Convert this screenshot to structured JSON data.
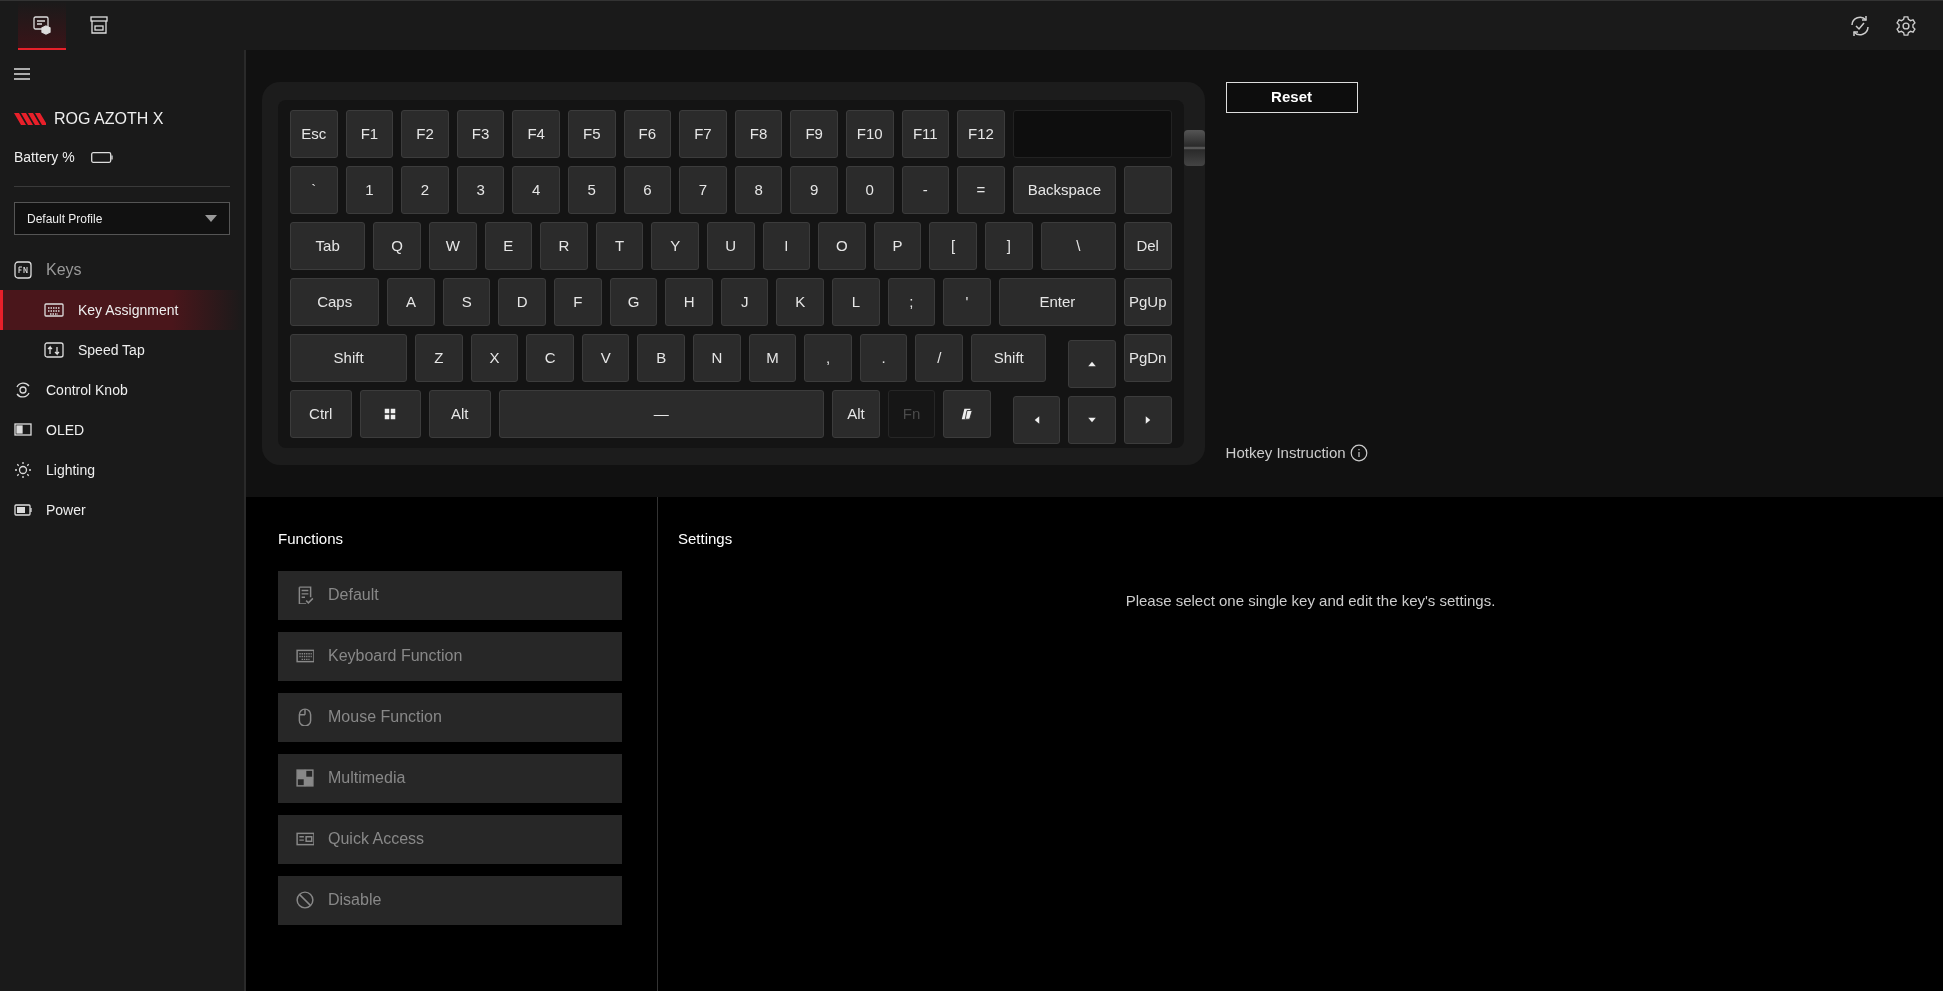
{
  "top_tabs": [
    {
      "selected": true
    },
    {
      "selected": false
    }
  ],
  "sidebar": {
    "device": "ROG AZOTH X",
    "battery_label": "Battery %",
    "profile": "Default Profile",
    "items": [
      {
        "label": "Keys",
        "children": [
          {
            "label": "Key Assignment",
            "selected": true
          },
          {
            "label": "Speed Tap",
            "selected": false
          }
        ]
      },
      {
        "label": "Control Knob",
        "selected": false
      },
      {
        "label": "OLED",
        "selected": false
      },
      {
        "label": "Lighting",
        "selected": false
      },
      {
        "label": "Power",
        "selected": false
      }
    ]
  },
  "keyboard": {
    "rows": [
      [
        {
          "kind": "key",
          "label": "Esc"
        },
        {
          "kind": "key",
          "label": "F1"
        },
        {
          "kind": "key",
          "label": "F2"
        },
        {
          "kind": "key",
          "label": "F3"
        },
        {
          "kind": "key",
          "label": "F4"
        },
        {
          "kind": "key",
          "label": "F5"
        },
        {
          "kind": "key",
          "label": "F6"
        },
        {
          "kind": "key",
          "label": "F7"
        },
        {
          "kind": "key",
          "label": "F8"
        },
        {
          "kind": "key",
          "label": "F9"
        },
        {
          "kind": "key",
          "label": "F10"
        },
        {
          "kind": "key",
          "label": "F11"
        },
        {
          "kind": "key",
          "label": "F12"
        },
        {
          "kind": "display"
        }
      ],
      [
        {
          "kind": "key",
          "label": "`"
        },
        {
          "kind": "key",
          "label": "1"
        },
        {
          "kind": "key",
          "label": "2"
        },
        {
          "kind": "key",
          "label": "3"
        },
        {
          "kind": "key",
          "label": "4"
        },
        {
          "kind": "key",
          "label": "5"
        },
        {
          "kind": "key",
          "label": "6"
        },
        {
          "kind": "key",
          "label": "7"
        },
        {
          "kind": "key",
          "label": "8"
        },
        {
          "kind": "key",
          "label": "9"
        },
        {
          "kind": "key",
          "label": "0"
        },
        {
          "kind": "key",
          "label": "-"
        },
        {
          "kind": "key",
          "label": "="
        },
        {
          "kind": "key",
          "label": "Backspace"
        },
        {
          "kind": "blank"
        }
      ],
      [
        {
          "kind": "key",
          "label": "Tab"
        },
        {
          "kind": "key",
          "label": "Q"
        },
        {
          "kind": "key",
          "label": "W"
        },
        {
          "kind": "key",
          "label": "E"
        },
        {
          "kind": "key",
          "label": "R"
        },
        {
          "kind": "key",
          "label": "T"
        },
        {
          "kind": "key",
          "label": "Y"
        },
        {
          "kind": "key",
          "label": "U"
        },
        {
          "kind": "key",
          "label": "I"
        },
        {
          "kind": "key",
          "label": "O"
        },
        {
          "kind": "key",
          "label": "P"
        },
        {
          "kind": "key",
          "label": "["
        },
        {
          "kind": "key",
          "label": "]"
        },
        {
          "kind": "key",
          "label": "\\"
        },
        {
          "kind": "key",
          "label": "Del"
        }
      ],
      [
        {
          "kind": "key",
          "label": "Caps"
        },
        {
          "kind": "key",
          "label": "A"
        },
        {
          "kind": "key",
          "label": "S"
        },
        {
          "kind": "key",
          "label": "D"
        },
        {
          "kind": "key",
          "label": "F"
        },
        {
          "kind": "key",
          "label": "G"
        },
        {
          "kind": "key",
          "label": "H"
        },
        {
          "kind": "key",
          "label": "J"
        },
        {
          "kind": "key",
          "label": "K"
        },
        {
          "kind": "key",
          "label": "L"
        },
        {
          "kind": "key",
          "label": ";"
        },
        {
          "kind": "key",
          "label": "'"
        },
        {
          "kind": "key",
          "label": "Enter"
        },
        {
          "kind": "key",
          "label": "PgUp"
        }
      ],
      [
        {
          "kind": "key",
          "label": "Shift"
        },
        {
          "kind": "key",
          "label": "Z"
        },
        {
          "kind": "key",
          "label": "X"
        },
        {
          "kind": "key",
          "label": "C"
        },
        {
          "kind": "key",
          "label": "V"
        },
        {
          "kind": "key",
          "label": "B"
        },
        {
          "kind": "key",
          "label": "N"
        },
        {
          "kind": "key",
          "label": "M"
        },
        {
          "kind": "key",
          "label": ","
        },
        {
          "kind": "key",
          "label": "."
        },
        {
          "kind": "key",
          "label": "/"
        },
        {
          "kind": "key",
          "label": "Shift"
        },
        {
          "kind": "arrowup"
        },
        {
          "kind": "key",
          "label": "PgDn"
        }
      ],
      [
        {
          "kind": "key",
          "label": "Ctrl"
        },
        {
          "kind": "winkey"
        },
        {
          "kind": "key",
          "label": "Alt"
        },
        {
          "kind": "key",
          "label": "—"
        },
        {
          "kind": "key",
          "label": "Alt"
        },
        {
          "kind": "dimmed",
          "label": "Fn"
        },
        {
          "kind": "copilotkey"
        },
        {
          "kind": "arrowleft"
        },
        {
          "kind": "arrowdown"
        },
        {
          "kind": "arrowright"
        }
      ]
    ]
  },
  "reset_button": "Reset",
  "hotkey_instruction": "Hotkey Instruction",
  "functions": {
    "title": "Functions",
    "items": [
      "Default",
      "Keyboard Function",
      "Mouse Function",
      "Multimedia",
      "Quick Access",
      "Disable"
    ]
  },
  "settings": {
    "title": "Settings",
    "message": "Please select one single key and edit the key's settings."
  }
}
